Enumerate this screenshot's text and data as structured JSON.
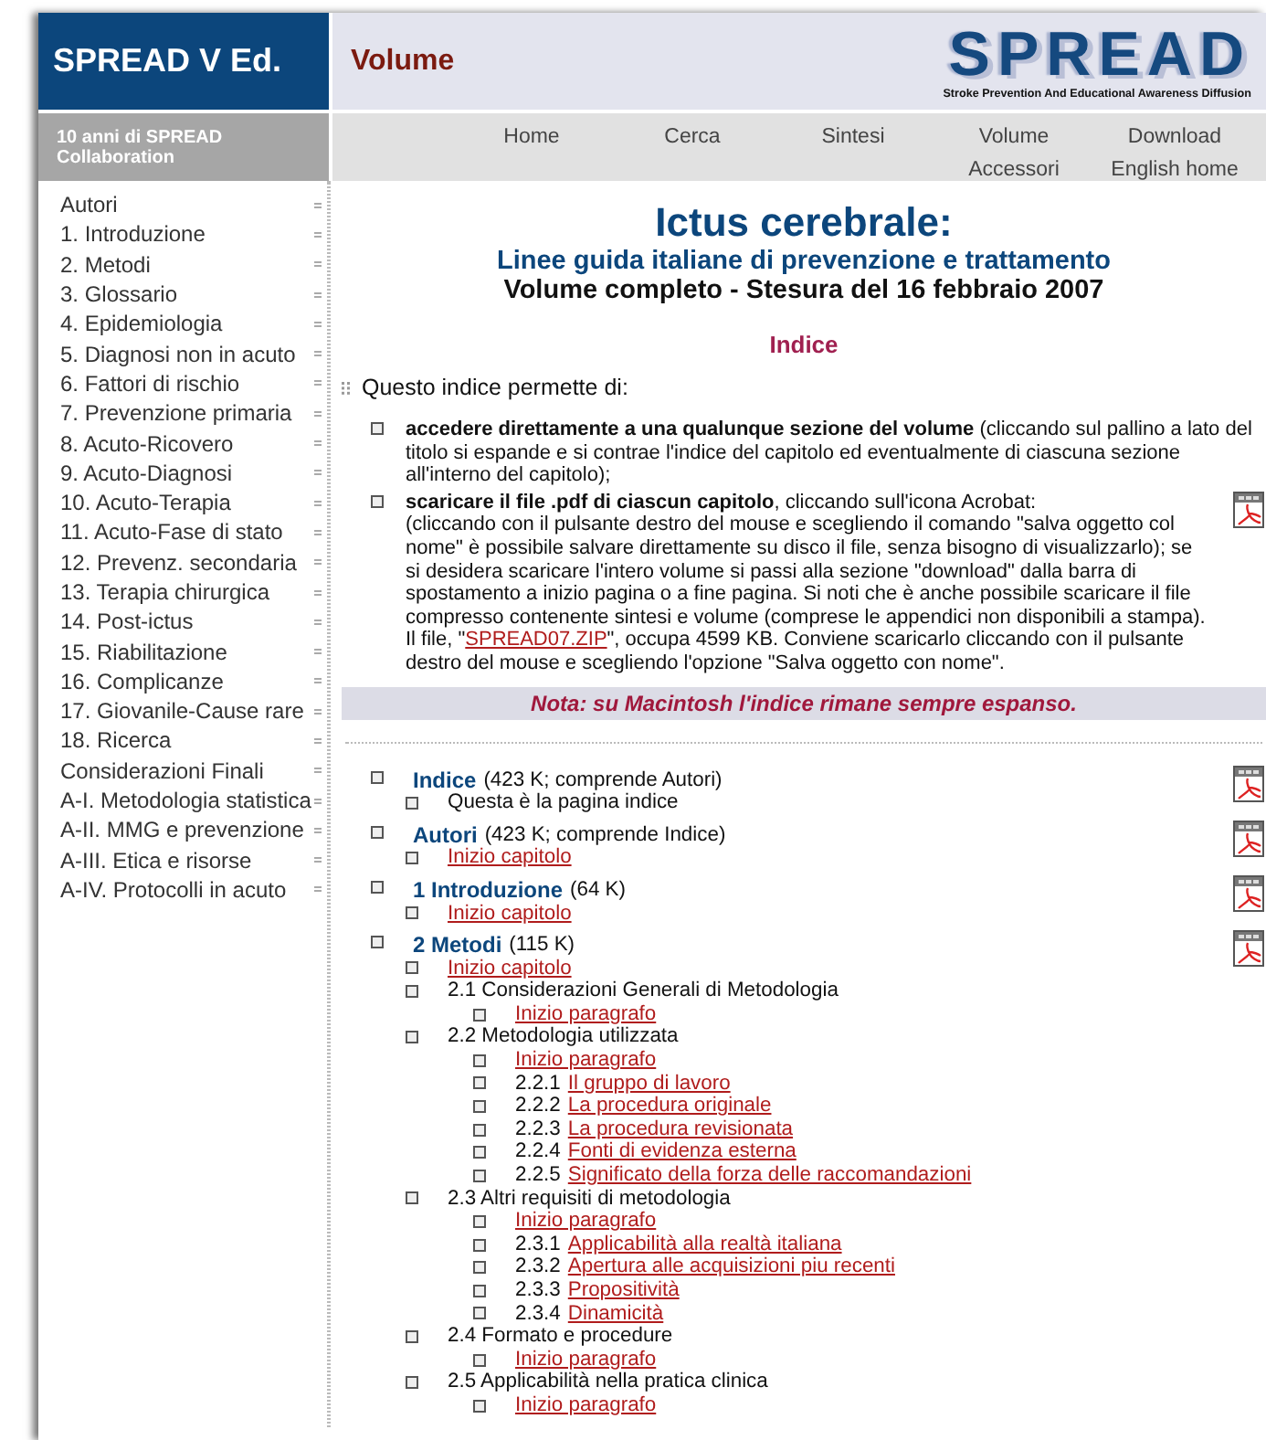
{
  "header": {
    "brand": "SPREAD V Ed.",
    "section": "Volume",
    "logo": "SPREAD",
    "logo_tagline": "Stroke Prevention And Educational Awareness Diffusion"
  },
  "subheader": "10 anni di SPREAD Collaboration",
  "nav": [
    {
      "label": "Home"
    },
    {
      "label": "Cerca"
    },
    {
      "label": "Sintesi"
    },
    {
      "label": "Volume",
      "sub": "Accessori"
    },
    {
      "label": "Download",
      "sub": "English home"
    }
  ],
  "sidebar": {
    "items": [
      "Autori",
      "1. Introduzione",
      "2. Metodi",
      "3. Glossario",
      "4. Epidemiologia",
      "5. Diagnosi non in acuto",
      "6. Fattori di rischio",
      "7. Prevenzione primaria",
      "8. Acuto-Ricovero",
      "9. Acuto-Diagnosi",
      "10. Acuto-Terapia",
      "11. Acuto-Fase di stato",
      "12. Prevenz. secondaria",
      "13. Terapia chirurgica",
      "14. Post-ictus",
      "15. Riabilitazione",
      "16. Complicanze",
      "17. Giovanile-Cause rare",
      "18. Ricerca",
      "Considerazioni Finali",
      "A-I. Metodologia statistica",
      "A-II. MMG e prevenzione",
      "A-III. Etica e risorse",
      "A-IV. Protocolli in acuto"
    ]
  },
  "title": "Ictus cerebrale:",
  "subtitle": "Linee guida italiane di prevenzione e trattamento",
  "edition": "Volume completo - Stesura del 16 febbraio 2007",
  "index_heading": "Indice",
  "intro": "Questo indice permette di:",
  "bullets": [
    {
      "lead": "**accedere direttamente a una qualunque sezione del volume** (cliccando sul pallino a lato del titolo si espande e si contrae l'indice del capitolo ed eventualmente di ciascuna sezione all'interno del capitolo);"
    },
    {
      "lead": "**scaricare il file .pdf di ciascun capitolo**, cliccando sull'icona Acrobat:",
      "pdf": true,
      "body_before": "(cliccando con il pulsante destro del mouse e scegliendo il comando \"salva oggetto col nome\" è possibile salvare direttamente su disco il file, senza bisogno di visualizzarlo); se si desidera scaricare l'intero volume si passi alla sezione \"download\" dalla barra di spostamento a inizio pagina o a fine pagina. Si noti che è anche possibile scaricare il file compresso contenente sintesi e volume (comprese le appendici non disponibili a stampa). Il file, \"",
      "link": "SPREAD07.ZIP",
      "body_after": "\", occupa 4599 KB. Conviene scaricarlo cliccando con il pulsante destro del mouse e scegliendo l'opzione \"Salva oggetto con nome\"."
    }
  ],
  "note": "Nota: su Macintosh l'indice rimane sempre espanso.",
  "toc": [
    {
      "title": "Indice",
      "size": "(423 K; comprende Autori)",
      "pdf": true,
      "children": [
        {
          "text": "Questa è la pagina indice",
          "link": false
        }
      ]
    },
    {
      "title": "Autori",
      "size": "(423 K; comprende Indice)",
      "pdf": true,
      "children": [
        {
          "text": "Inizio capitolo",
          "link": true
        }
      ]
    },
    {
      "title": "1 Introduzione",
      "size": "(64 K)",
      "pdf": true,
      "children": [
        {
          "text": "Inizio capitolo",
          "link": true
        }
      ]
    },
    {
      "title": "2 Metodi",
      "size": "(115 K)",
      "pdf": true,
      "children": [
        {
          "text": "Inizio capitolo",
          "link": true
        },
        {
          "text": "2.1 Considerazioni Generali di Metodologia",
          "link": false,
          "children": [
            {
              "text": "Inizio paragrafo",
              "link": true
            }
          ]
        },
        {
          "text": "2.2 Metodologia utilizzata",
          "link": false,
          "children": [
            {
              "text": "Inizio paragrafo",
              "link": true
            },
            {
              "number": "2.2.1",
              "text": "Il gruppo di lavoro",
              "link": true
            },
            {
              "number": "2.2.2",
              "text": "La procedura originale",
              "link": true
            },
            {
              "number": "2.2.3",
              "text": "La procedura revisionata",
              "link": true
            },
            {
              "number": "2.2.4",
              "text": "Fonti di evidenza esterna",
              "link": true
            },
            {
              "number": "2.2.5",
              "text": "Significato della forza delle raccomandazioni",
              "link": true
            }
          ]
        },
        {
          "text": "2.3 Altri requisiti di metodologia",
          "link": false,
          "children": [
            {
              "text": "Inizio paragrafo",
              "link": true
            },
            {
              "number": "2.3.1",
              "text": "Applicabilità alla realtà italiana",
              "link": true
            },
            {
              "number": "2.3.2",
              "text": "Apertura alle acquisizioni piu recenti",
              "link": true
            },
            {
              "number": "2.3.3",
              "text": "Propositività",
              "link": true
            },
            {
              "number": "2.3.4",
              "text": "Dinamicità",
              "link": true
            }
          ]
        },
        {
          "text": "2.4 Formato e procedure",
          "link": false,
          "children": [
            {
              "text": "Inizio paragrafo",
              "link": true
            }
          ]
        },
        {
          "text": "2.5 Applicabilità nella pratica clinica",
          "link": false,
          "children": [
            {
              "text": "Inizio paragrafo",
              "link": true
            }
          ]
        }
      ]
    }
  ]
}
